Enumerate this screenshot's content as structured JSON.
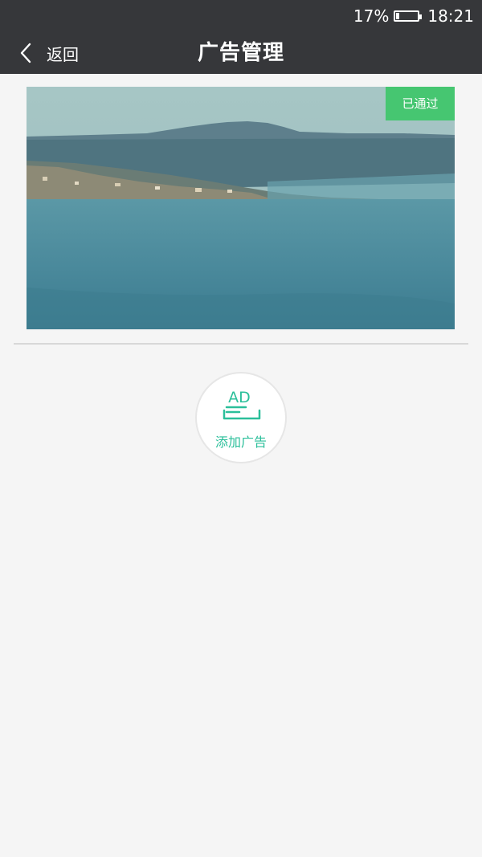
{
  "status_bar": {
    "battery_percent": "17%",
    "battery_level": 0.17,
    "time": "18:21"
  },
  "header": {
    "back_label": "返回",
    "title": "广告管理"
  },
  "ad_item": {
    "status": "已通过"
  },
  "add_ad": {
    "icon_text": "AD",
    "label": "添加广告"
  },
  "icons": {
    "back": "chevron-left-icon",
    "battery": "battery-icon",
    "add_ad": "ad-tray-icon"
  },
  "colors": {
    "header_bg": "#36373a",
    "page_bg": "#f5f5f5",
    "badge_green": "#46c671",
    "accent_teal": "#2bbf9a"
  }
}
